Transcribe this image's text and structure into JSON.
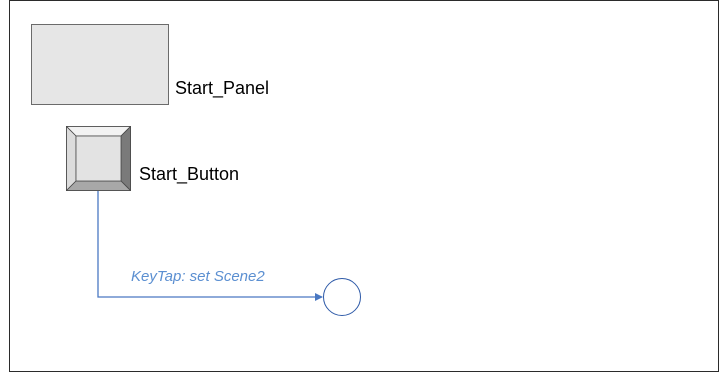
{
  "diagram": {
    "nodes": {
      "start_panel": {
        "label": "Start_Panel"
      },
      "start_button": {
        "label": "Start_Button"
      },
      "target_state": {
        "label": ""
      }
    },
    "transition": {
      "label": "KeyTap: set Scene2"
    }
  },
  "colors": {
    "transition": "#5b8fd1",
    "circle_stroke": "#2e5aa8",
    "panel_fill": "#e6e6e6"
  }
}
